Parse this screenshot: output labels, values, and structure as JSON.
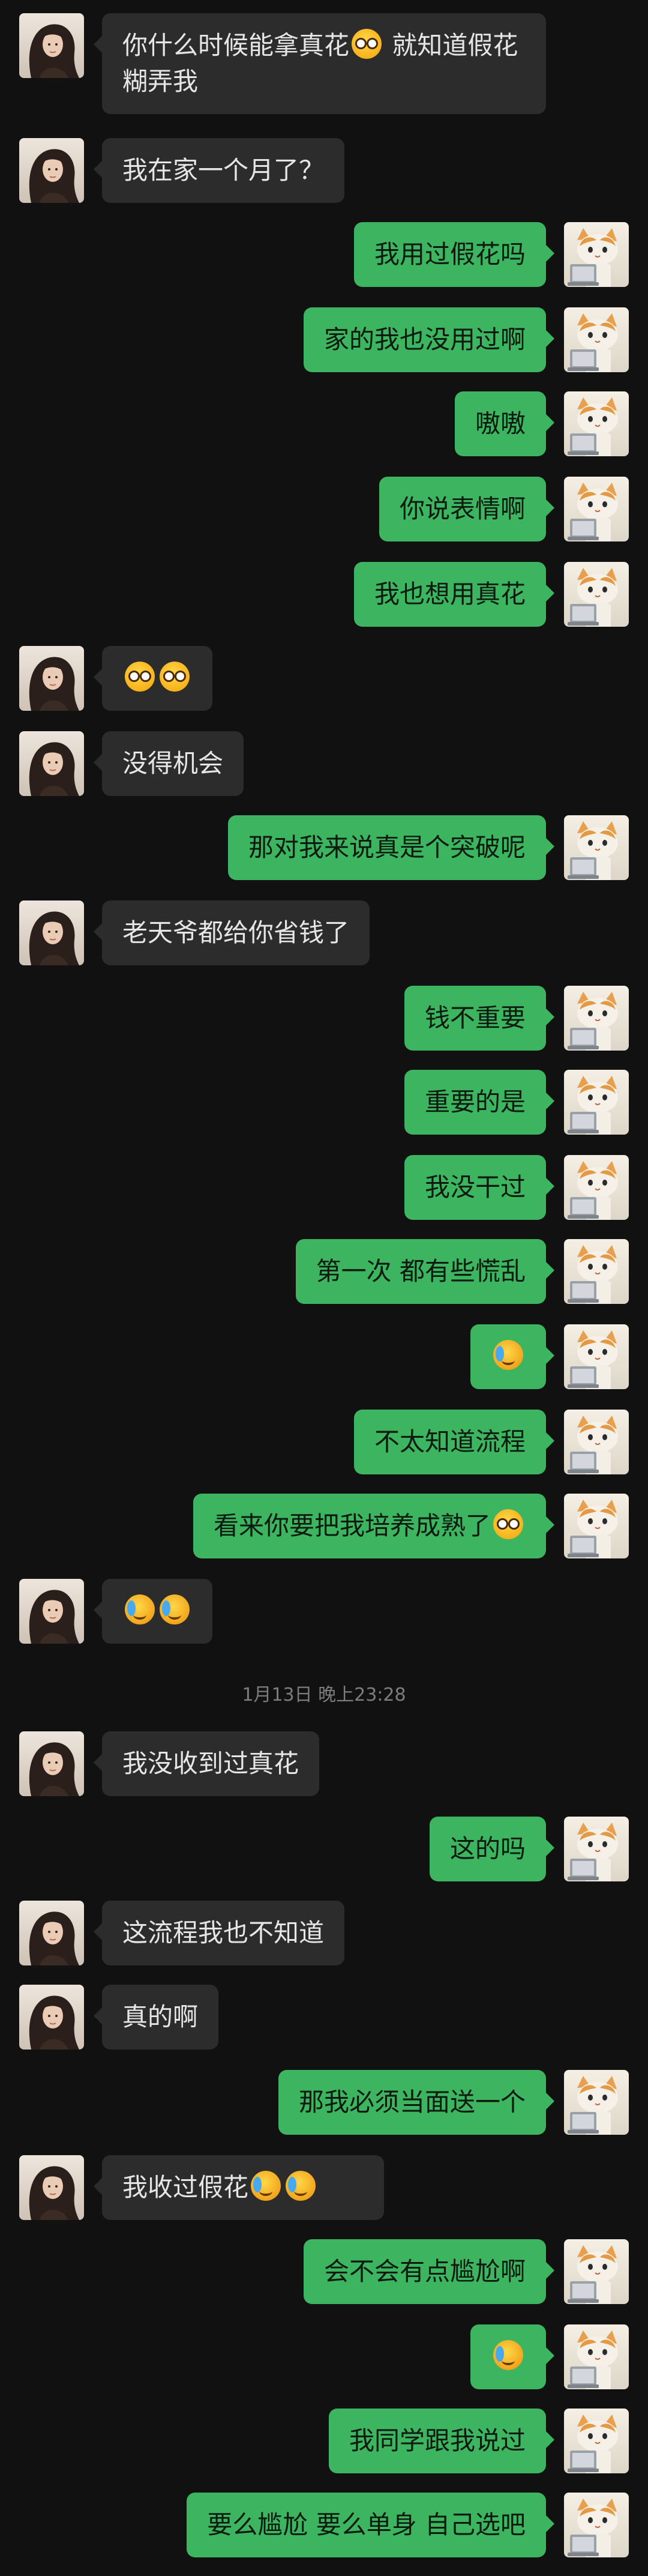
{
  "timestamp": "1月13日 晚上23:28",
  "colors": {
    "background": "#111111",
    "incoming_bubble": "#2c2c2c",
    "outgoing_bubble": "#3db45f"
  },
  "messages": [
    {
      "side": "left",
      "parts": [
        {
          "t": "你什么时候能拿真花"
        },
        {
          "e": "flushed-emoji"
        },
        {
          "t": " 就知道假花糊弄我"
        }
      ]
    },
    {
      "side": "left",
      "parts": [
        {
          "t": "我在家一个月了？"
        }
      ]
    },
    {
      "side": "right",
      "parts": [
        {
          "t": "我用过假花吗"
        }
      ]
    },
    {
      "side": "right",
      "parts": [
        {
          "t": "家的我也没用过啊"
        }
      ]
    },
    {
      "side": "right",
      "parts": [
        {
          "t": "嗷嗷"
        }
      ]
    },
    {
      "side": "right",
      "parts": [
        {
          "t": "你说表情啊"
        }
      ]
    },
    {
      "side": "right",
      "parts": [
        {
          "t": "我也想用真花"
        }
      ]
    },
    {
      "side": "left",
      "parts": [
        {
          "e": "flushed-emoji"
        },
        {
          "e": "flushed-emoji"
        }
      ]
    },
    {
      "side": "left",
      "parts": [
        {
          "t": "没得机会"
        }
      ]
    },
    {
      "side": "right",
      "parts": [
        {
          "t": "那对我来说真是个突破呢"
        }
      ]
    },
    {
      "side": "left",
      "parts": [
        {
          "t": "老天爷都给你省钱了"
        }
      ]
    },
    {
      "side": "right",
      "parts": [
        {
          "t": "钱不重要"
        }
      ]
    },
    {
      "side": "right",
      "parts": [
        {
          "t": "重要的是"
        }
      ]
    },
    {
      "side": "right",
      "parts": [
        {
          "t": "我没干过"
        }
      ]
    },
    {
      "side": "right",
      "parts": [
        {
          "t": "第一次 都有些慌乱"
        }
      ]
    },
    {
      "side": "right",
      "parts": [
        {
          "e": "crying-laughing-emoji"
        }
      ]
    },
    {
      "side": "right",
      "parts": [
        {
          "t": "不太知道流程"
        }
      ]
    },
    {
      "side": "right",
      "parts": [
        {
          "t": "看来你要把我培养成熟了"
        },
        {
          "e": "flushed-emoji"
        }
      ]
    },
    {
      "side": "left",
      "parts": [
        {
          "e": "crying-laughing-emoji"
        },
        {
          "e": "crying-laughing-emoji"
        }
      ]
    },
    {
      "side": "left",
      "parts": [
        {
          "t": "我没收到过真花"
        }
      ]
    },
    {
      "side": "right",
      "parts": [
        {
          "t": "这的吗"
        }
      ]
    },
    {
      "side": "left",
      "parts": [
        {
          "t": "这流程我也不知道"
        }
      ]
    },
    {
      "side": "left",
      "parts": [
        {
          "t": "真的啊"
        }
      ]
    },
    {
      "side": "right",
      "parts": [
        {
          "t": "那我必须当面送一个"
        }
      ]
    },
    {
      "side": "left",
      "parts": [
        {
          "t": "我收过假花"
        },
        {
          "e": "crying-laughing-emoji"
        },
        {
          "e": "crying-laughing-emoji"
        }
      ]
    },
    {
      "side": "right",
      "parts": [
        {
          "t": "会不会有点尴尬啊"
        }
      ]
    },
    {
      "side": "right",
      "parts": [
        {
          "e": "crying-laughing-emoji"
        }
      ]
    },
    {
      "side": "right",
      "parts": [
        {
          "t": "我同学跟我说过"
        }
      ]
    },
    {
      "side": "right",
      "parts": [
        {
          "t": "要么尴尬  要么单身 自己选吧"
        }
      ]
    }
  ]
}
